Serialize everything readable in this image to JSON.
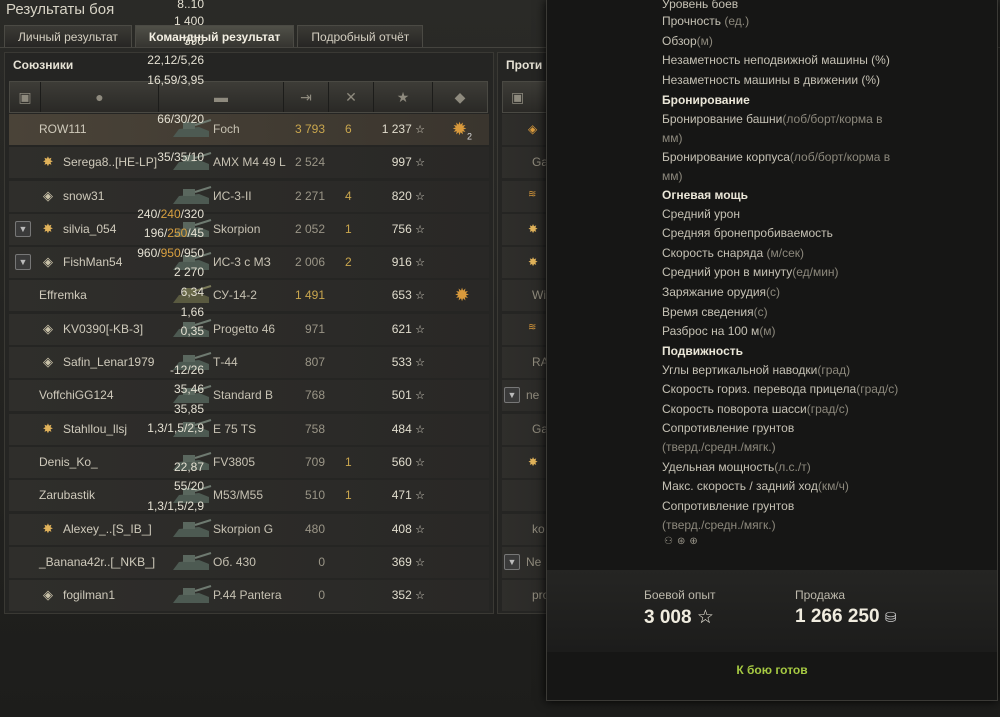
{
  "window": {
    "title": "Результаты боя"
  },
  "tabs": [
    {
      "label": "Личный результат"
    },
    {
      "label": "Командный результат"
    },
    {
      "label": "Подробный отчёт"
    }
  ],
  "allies": {
    "title": "Союзники",
    "players": [
      {
        "name": "ROW111",
        "vehicle": "Foch",
        "damage": "3 793",
        "frags": "6",
        "xp": "1 237",
        "medal": "2"
      },
      {
        "name": "Serega8..[HE-LP]",
        "vehicle": "AMX M4 49 L",
        "damage": "2 524",
        "frags": "",
        "xp": "997"
      },
      {
        "name": "snow31",
        "vehicle": "ИС-3-II",
        "damage": "2 271",
        "frags": "4",
        "xp": "820"
      },
      {
        "name": "silvia_054",
        "vehicle": "Skorpion",
        "damage": "2 052",
        "frags": "1",
        "xp": "756"
      },
      {
        "name": "FishMan54",
        "vehicle": "ИС-3 с МЗ",
        "damage": "2 006",
        "frags": "2",
        "xp": "916"
      },
      {
        "name": "Effremka",
        "vehicle": "СУ-14-2",
        "damage": "1 491",
        "frags": "",
        "xp": "653"
      },
      {
        "name": "KV0390[-KB-3]",
        "vehicle": "Progetto 46",
        "damage": "971",
        "frags": "",
        "xp": "621"
      },
      {
        "name": "Safin_Lenar1979",
        "vehicle": "Т-44",
        "damage": "807",
        "frags": "",
        "xp": "533"
      },
      {
        "name": "VoffchiGG124",
        "vehicle": "Standard B",
        "damage": "768",
        "frags": "",
        "xp": "501"
      },
      {
        "name": "Stahllou_llsj",
        "vehicle": "E 75 TS",
        "damage": "758",
        "frags": "",
        "xp": "484"
      },
      {
        "name": "Denis_Ko_",
        "vehicle": "FV3805",
        "damage": "709",
        "frags": "1",
        "xp": "560"
      },
      {
        "name": "Zarubastik",
        "vehicle": "M53/M55",
        "damage": "510",
        "frags": "1",
        "xp": "471"
      },
      {
        "name": "Alexey_..[S_IB_]",
        "vehicle": "Skorpion G",
        "damage": "480",
        "frags": "",
        "xp": "408"
      },
      {
        "name": "_Banana42r..[_NKB_]",
        "vehicle": "Об. 430",
        "damage": "0",
        "frags": "",
        "xp": "369"
      },
      {
        "name": "fogilman1",
        "vehicle": "P.44 Pantera",
        "damage": "0",
        "frags": "",
        "xp": "352"
      }
    ]
  },
  "enemies": {
    "title": "Проти",
    "names": [
      "",
      "Ga",
      "",
      "",
      "",
      "Wi",
      "",
      "RA",
      "ne",
      "Ga",
      "",
      "",
      "ko",
      "Ne",
      "pro"
    ]
  },
  "tooltip": {
    "tier_value": "8..10",
    "tier_label": "Уровень боев",
    "hp_value": "1 400",
    "hp_label": "Прочность",
    "hp_unit": "(ед.)",
    "view_value": "390",
    "view_label": "Обзор",
    "view_unit": "(м)",
    "camo_static_value": "22,12/5,26",
    "camo_static_label": "Незаметность неподвижной машины (%)",
    "camo_moving_value": "16,59/3,95",
    "camo_moving_label": "Незаметность машины в движении (%)",
    "armor_section": "Бронирование",
    "turret_value": "66/30/20",
    "turret_label": "Бронирование башни",
    "turret_unit": "(лоб/борт/корма в",
    "turret_unit2": "мм)",
    "hull_value": "35/35/10",
    "hull_label": "Бронирование корпуса",
    "hull_unit": "(лоб/борт/корма в",
    "hull_unit2": "мм)",
    "fire_section": "Огневая мощь",
    "dmg_v1": "240/",
    "dmg_v2": "240",
    "dmg_v3": "/320",
    "dmg_label": "Средний урон",
    "pen_v1": "196/",
    "pen_v2": "250",
    "pen_v3": "/45",
    "pen_label": "Средняя бронепробиваемость",
    "vel_v1": "960/",
    "vel_v2": "950",
    "vel_v3": "/950",
    "vel_label": "Скорость снаряда",
    "vel_unit": " (м/сек)",
    "dpm_value": "2 270",
    "dpm_label": "Средний урон в минуту",
    "dpm_unit": "(ед/мин)",
    "reload_value": "6,34",
    "reload_label": "Заряжание орудия",
    "reload_unit": "(с)",
    "aim_value": "1,66",
    "aim_label": "Время сведения",
    "aim_unit": "(с)",
    "disp_value": "0,35",
    "disp_label": "Разброс на 100 м",
    "disp_unit": "(м)",
    "mob_section": "Подвижность",
    "elev_value": "-12/26",
    "elev_label": "Углы вертикальной наводки",
    "elev_unit": "(град)",
    "trav_value": "35,46",
    "trav_label": "Скорость гориз. перевода прицела",
    "trav_unit": "(град/с)",
    "hulltrav_value": "35,85",
    "hulltrav_label": "Скорость поворота шасси",
    "hulltrav_unit": "(град/с)",
    "terr1_value": "1,3/1,5/2,9",
    "terr1_label": "Сопротивление грунтов",
    "terr1_label2": "(тверд./средн./мягк.)",
    "pw_value": "22,87",
    "pw_label": "Удельная мощность",
    "pw_unit": "(л.с./т)",
    "speed_value": "55/20",
    "speed_label": "Макс. скорость / задний ход",
    "speed_unit": "(км/ч)",
    "terr2_value": "1,3/1,5/2,9",
    "terr2_label": "Сопротивление грунтов",
    "terr2_label2": "(тверд./средн./мягк.)",
    "xp_label": "Боевой опыт",
    "xp_value": "3 008",
    "sale_label": "Продажа",
    "sale_value": "1 266 250",
    "status": "К бою готов"
  }
}
